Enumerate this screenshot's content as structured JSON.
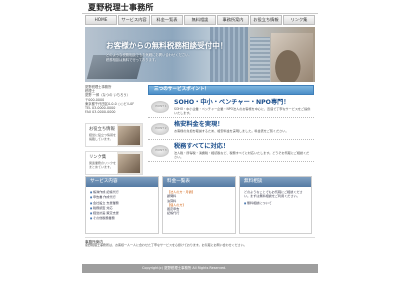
{
  "site": {
    "logo": "夏野税理士事務所"
  },
  "nav": [
    "HOME",
    "サービス内容",
    "料金一覧表",
    "無料相談",
    "事務所案内",
    "お役立ち情報",
    "リンク集"
  ],
  "hero": {
    "title": "お客様からの無料税務相談受付中！",
    "lines": [
      "どのような税務相談でもお気軽にお問い合わせください。",
      "税務相談は無料で行っております。"
    ]
  },
  "sidebar": {
    "address": [
      "夏野税理士事務所",
      "税理士",
      "夏野 一郎（なつの いちろう）",
      "〒000-0000",
      "東京都千代田区0-0-0 ○○ビル0F",
      "TEL 03-0000-0000",
      "FAX 03-0000-0000"
    ],
    "banners": [
      {
        "title": "お役立ち情報",
        "text": "経営に役立つ情報を掲載しています。"
      },
      {
        "title": "リンク集",
        "text": "関連業務のリンクをまとめています。"
      }
    ]
  },
  "points": {
    "header": "三つのサービスポイント！",
    "items": [
      {
        "badge": "POINT 1",
        "title": "SOHO・中小・ベンチャー・NPO専門！",
        "text": "SOHO・中小企業・ベンチャー企業・NPO法人のお客様を中心に、迅速で丁寧なサービスをご提供いたします。"
      },
      {
        "badge": "POINT 2",
        "title": "格安料金を実現！",
        "text": "お客様の負担を軽減するため、格安料金を実現しました。料金表をご覧ください。"
      },
      {
        "badge": "POINT 3",
        "title": "税務すべてに対応！",
        "text": "法人税・所得税・消費税・相続税など、税務すべてに対応いたします。どうぞお気軽にご相談ください。"
      }
    ]
  },
  "boxes": [
    {
      "header": "サービス内容",
      "items": [
        "帳簿作成 記帳代行",
        "申告書 作成代行",
        "会社設立 支援業務",
        "税務調査 対応",
        "経営計画 策定支援",
        "その他税務業務"
      ]
    },
    {
      "header": "料金一覧表",
      "items": [
        "【法人の方・月額】",
        "顧問料",
        "決算料",
        "【個人の方】",
        "確定申告",
        "記帳代行"
      ]
    },
    {
      "header": "無料相談",
      "text": "どのようなことでもお気軽にご相談ください。まずは無料相談をご利用ください。",
      "link": "無料相談について"
    }
  ],
  "about": {
    "heading": "事務所案内",
    "text": "夏野税理士事務所は、お客様一人一人に合わせた丁寧なサービスを心掛けております。お気軽にお問い合わせください。"
  },
  "footer": {
    "copyright": "Copyright(c) 夏野税理士事務所 All Rights Reserved."
  }
}
